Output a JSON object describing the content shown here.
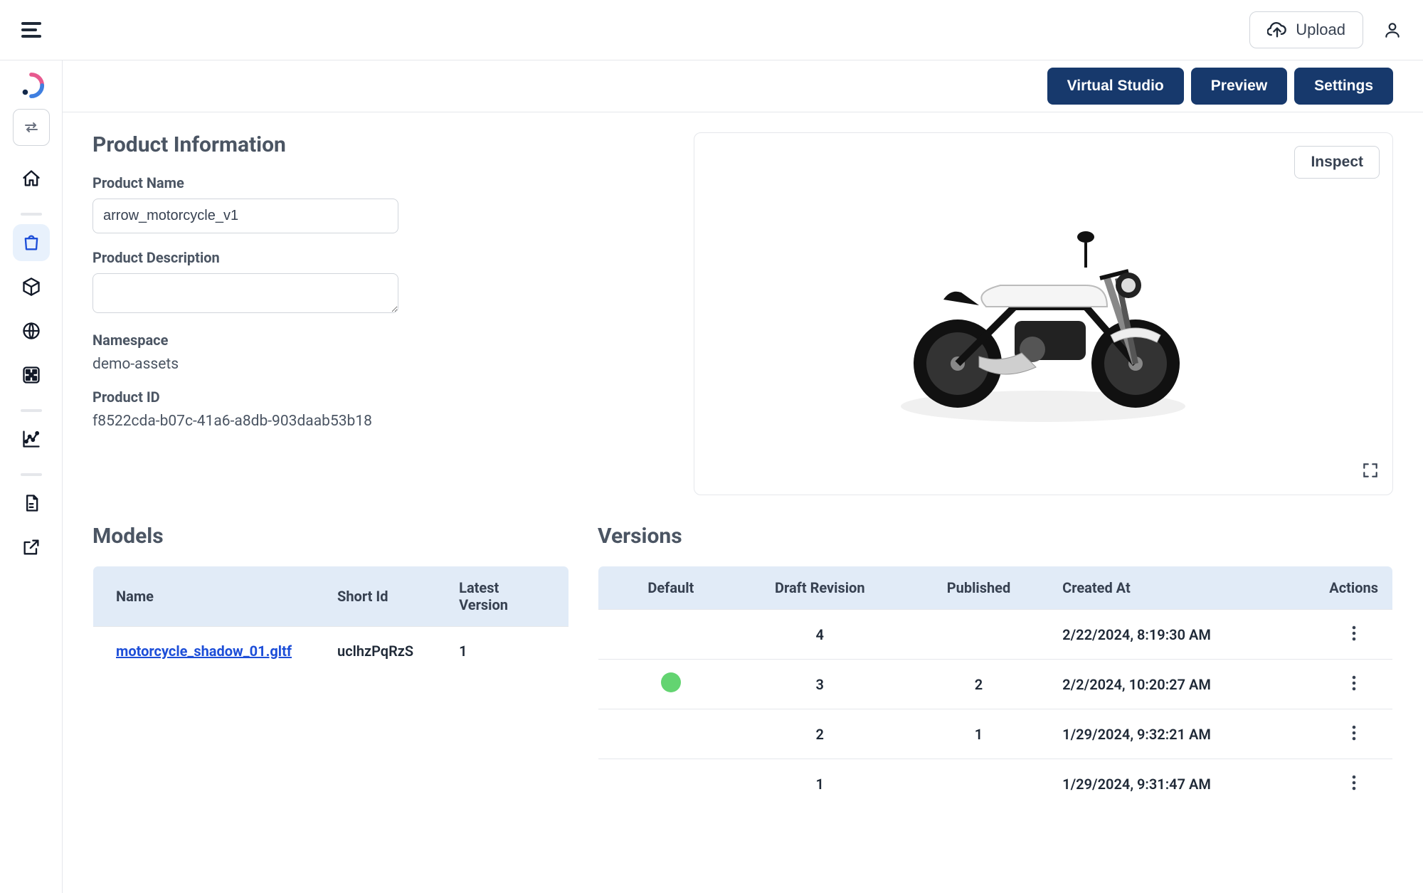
{
  "topbar": {
    "upload_label": "Upload"
  },
  "actions": {
    "virtual_studio": "Virtual Studio",
    "preview": "Preview",
    "settings": "Settings"
  },
  "preview_panel": {
    "inspect_label": "Inspect"
  },
  "product_info": {
    "title": "Product Information",
    "name_label": "Product Name",
    "name_value": "arrow_motorcycle_v1",
    "description_label": "Product Description",
    "description_value": "",
    "namespace_label": "Namespace",
    "namespace_value": "demo-assets",
    "product_id_label": "Product ID",
    "product_id_value": "f8522cda-b07c-41a6-a8db-903daab53b18"
  },
  "models": {
    "title": "Models",
    "headers": {
      "name": "Name",
      "short_id": "Short Id",
      "latest_version": "Latest Version"
    },
    "rows": [
      {
        "name": "motorcycle_shadow_01.gltf",
        "short_id": "uclhzPqRzS",
        "latest_version": "1"
      }
    ]
  },
  "versions": {
    "title": "Versions",
    "headers": {
      "default": "Default",
      "draft": "Draft Revision",
      "published": "Published",
      "created": "Created At",
      "actions": "Actions"
    },
    "rows": [
      {
        "default": false,
        "draft": "4",
        "published": "",
        "created": "2/22/2024, 8:19:30 AM"
      },
      {
        "default": true,
        "draft": "3",
        "published": "2",
        "created": "2/2/2024, 10:20:27 AM"
      },
      {
        "default": false,
        "draft": "2",
        "published": "1",
        "created": "1/29/2024, 9:32:21 AM"
      },
      {
        "default": false,
        "draft": "1",
        "published": "",
        "created": "1/29/2024, 9:31:47 AM"
      }
    ]
  }
}
